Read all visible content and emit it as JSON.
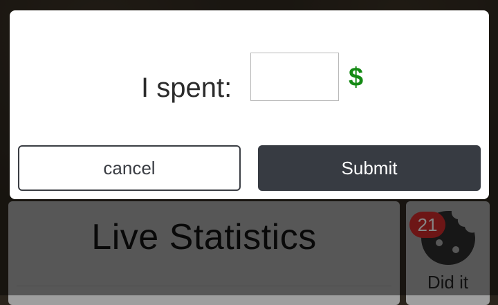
{
  "dialog": {
    "label": "I spent:",
    "amount_value": "",
    "currency_symbol": "$",
    "cancel_label": "cancel",
    "submit_label": "Submit"
  },
  "background": {
    "stats_title": "Live Statistics",
    "did_it_count": "21",
    "did_it_label": "Did it",
    "did_it_icon": "cookie-icon"
  },
  "colors": {
    "currency": "#148a14",
    "submit_bg": "#373b42",
    "badge": "#c62828"
  }
}
